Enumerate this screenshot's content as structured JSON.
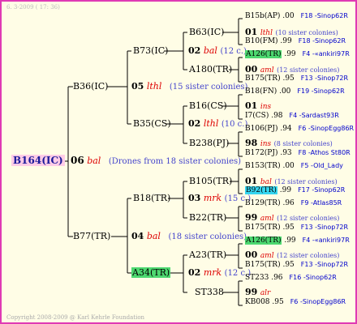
{
  "header": "6. 3-2009 ( 17: 36)",
  "footer": "Copyright 2008-2009 @ Karl Kehrle Foundation",
  "root": {
    "id": "B164(IC)",
    "year": "06",
    "race": "bal",
    "note": "(Drones from 18 sister colonies)"
  },
  "gen1": [
    {
      "id": "B36(IC)",
      "year": "05",
      "race": "lthl",
      "note": "(15 sister colonies)"
    },
    {
      "id": "B77(TR)",
      "year": "04",
      "race": "bal",
      "note": "(18 sister colonies)"
    }
  ],
  "gen2": [
    {
      "id": "B73(IC)",
      "year": "02",
      "race": "bal",
      "note": "(12 c.)"
    },
    {
      "id": "B35(CS)",
      "year": "02",
      "race": "lthl",
      "note": "(10 c.)"
    },
    {
      "id": "B18(TR)",
      "year": "03",
      "race": "mrk",
      "note": "(15 c.)"
    },
    {
      "id": "A34(TR)",
      "year": "02",
      "race": "mrk",
      "note": "(12 c.)"
    }
  ],
  "gen3": [
    {
      "id": "B63(IC)",
      "year": "01",
      "race": "lthl",
      "note": "(10 sister colonies)"
    },
    {
      "id": "A180(TR)",
      "year": "00",
      "race": "aml",
      "note": "(12 sister colonies)"
    },
    {
      "id": "B16(CS)",
      "year": "01",
      "race": "ins",
      "note": ""
    },
    {
      "id": "B238(PJ)",
      "year": "98",
      "race": "ins",
      "note": "(8 sister colonies)"
    },
    {
      "id": "B105(TR)",
      "year": "01",
      "race": "bal",
      "note": "(12 sister colonies)"
    },
    {
      "id": "B22(TR)",
      "year": "99",
      "race": "aml",
      "note": "(12 sister colonies)"
    },
    {
      "id": "A23(TR)",
      "year": "00",
      "race": "aml",
      "note": "(12 sister colonies)"
    },
    {
      "id": "ST338",
      "year": "99",
      "race": "alr",
      "note": ""
    }
  ],
  "gen4": [
    {
      "id": "B15b(AP)",
      "val": ".00",
      "loc": "F18 -Sinop62R",
      "hl": ""
    },
    {
      "id": "B10(FM)",
      "val": ".99",
      "loc": "F18 -Sinop62R",
      "hl": ""
    },
    {
      "id": "A126(TR)",
      "val": ".99",
      "loc": "F4 -«ankiri97R",
      "hl": "g"
    },
    {
      "id": "B175(TR)",
      "val": ".95",
      "loc": "F13 -Sinop72R",
      "hl": ""
    },
    {
      "id": "B18(FN)",
      "val": ".00",
      "loc": "F19 -Sinop62R",
      "hl": ""
    },
    {
      "id": "I7(CS)",
      "val": ".98",
      "loc": "F4 -Sardast93R",
      "hl": ""
    },
    {
      "id": "B106(PJ)",
      "val": ".94",
      "loc": "F6 -SinopEgg86R",
      "hl": ""
    },
    {
      "id": "B172(PJ)",
      "val": ".93",
      "loc": "F8 -Athos St80R",
      "hl": ""
    },
    {
      "id": "B153(TR)",
      "val": ".00",
      "loc": "F5 -Old_Lady",
      "hl": ""
    },
    {
      "id": "B92(TR)",
      "val": ".99",
      "loc": "F17 -Sinop62R",
      "hl": "c"
    },
    {
      "id": "B129(TR)",
      "val": ".96",
      "loc": "F9 -Atlas85R",
      "hl": ""
    },
    {
      "id": "B175(TR)",
      "val": ".95",
      "loc": "F13 -Sinop72R",
      "hl": ""
    },
    {
      "id": "A126(TR)",
      "val": ".99",
      "loc": "F4 -«ankiri97R",
      "hl": "g"
    },
    {
      "id": "B175(TR)",
      "val": ".95",
      "loc": "F13 -Sinop72R",
      "hl": ""
    },
    {
      "id": "ST233",
      "val": ".96",
      "loc": "F16 -Sinop62R",
      "hl": ""
    },
    {
      "id": "KB008",
      "val": ".95",
      "loc": "F6 -SinopEgg86R",
      "hl": ""
    }
  ]
}
